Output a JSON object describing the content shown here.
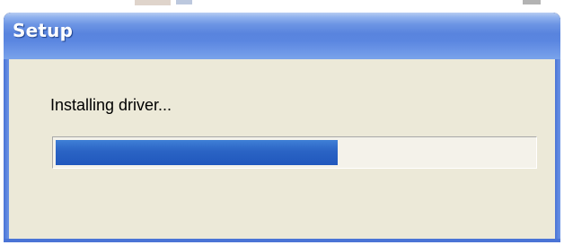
{
  "window": {
    "title": "Setup"
  },
  "dialog": {
    "status_text": "Installing driver...",
    "progress_fraction": 0.59
  },
  "colors": {
    "title_bar": "#5984de",
    "client_background": "#ece9d8",
    "progress_fill": "#2a63c4"
  }
}
